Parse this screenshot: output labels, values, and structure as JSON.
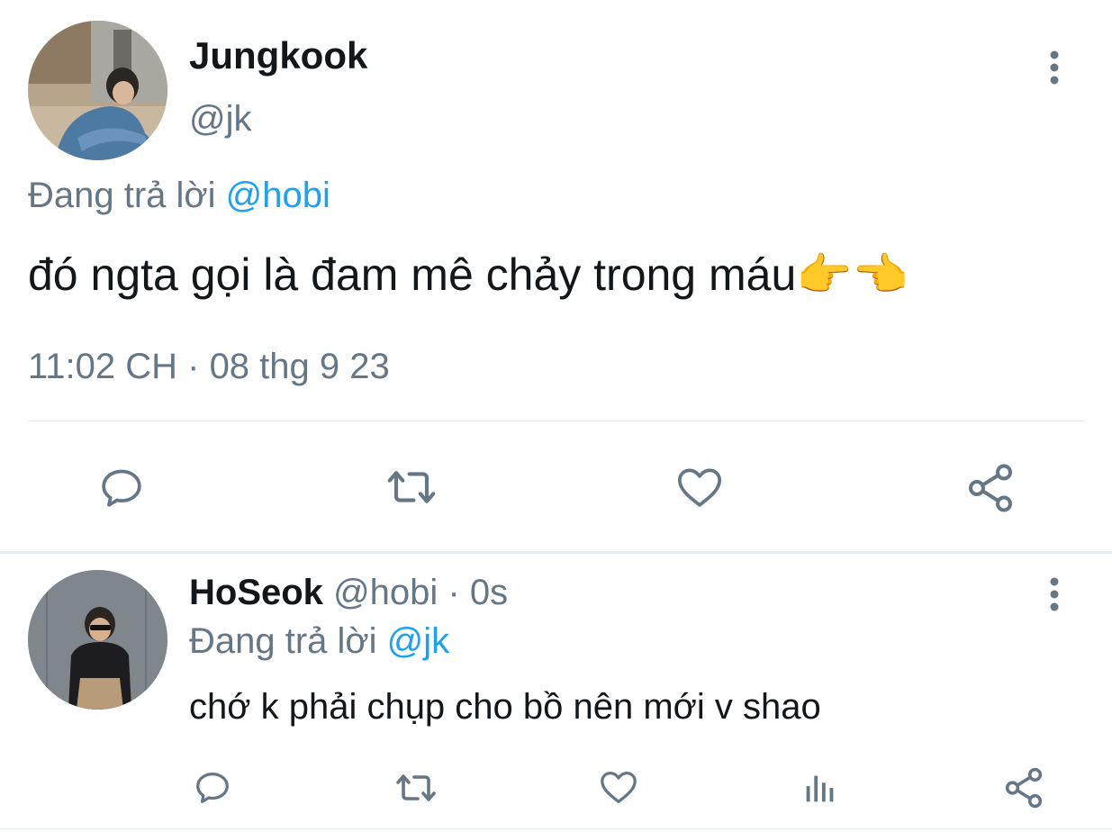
{
  "tweet": {
    "author_name": "Jungkook",
    "author_handle": "@jk",
    "replying_prefix": "Đang trả lời",
    "replying_to": "@hobi",
    "text": "đó ngta gọi là đam mê chảy trong máu",
    "emoji": "👉👈",
    "timestamp": "11:02 CH · 08 thg 9 23"
  },
  "reply": {
    "author_name": "HoSeok",
    "author_handle": "@hobi",
    "time": "· 0s",
    "replying_prefix": "Đang trả lời",
    "replying_to": "@jk",
    "text": "chớ k phải chụp cho bồ nên mới v shao"
  },
  "icons": {
    "more": "more-vertical-icon",
    "reply": "reply-icon",
    "retweet": "retweet-icon",
    "like": "heart-icon",
    "share": "share-icon",
    "analytics": "analytics-icon"
  },
  "colors": {
    "text": "#14171a",
    "muted": "#657786",
    "link": "#1da1f2",
    "divider": "#e1e8ed"
  }
}
